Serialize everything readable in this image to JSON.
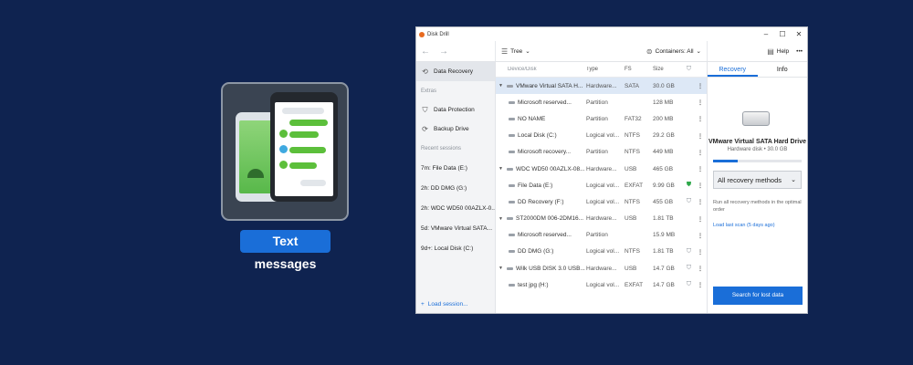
{
  "promo": {
    "label": "Text messages"
  },
  "window": {
    "title": "Disk Drill",
    "controls": {
      "minimize": "–",
      "maximize": "☐",
      "close": "✕"
    }
  },
  "toolbar": {
    "back": "←",
    "forward": "→",
    "view_label": "Tree",
    "containers_label": "Containers: All",
    "help_label": "Help",
    "more": "•••"
  },
  "sidebar": {
    "data_recovery": "Data Recovery",
    "extras_heading": "Extras",
    "data_protection": "Data Protection",
    "backup_drive": "Backup Drive",
    "recent_heading": "Recent sessions",
    "sessions": [
      "7m: File Data (E:)",
      "2h: DD DMG (G:)",
      "2h: WDC WD50 00AZLX-0...",
      "5d: VMware Virtual SATA...",
      "9d+: Local Disk (C:)"
    ],
    "load_session": "Load session..."
  },
  "columns": {
    "device": "Device/Disk",
    "type": "Type",
    "fs": "FS",
    "size": "Size"
  },
  "rows": [
    {
      "name": "VMware Virtual SATA H...",
      "type": "Hardware...",
      "fs": "SATA",
      "size": "30.0 GB",
      "level": 0
    },
    {
      "name": "Microsoft reserved...",
      "type": "Partition",
      "fs": "",
      "size": "128 MB",
      "level": 1
    },
    {
      "name": "NO NAME",
      "type": "Partition",
      "fs": "FAT32",
      "size": "200 MB",
      "level": 1
    },
    {
      "name": "Local Disk (C:)",
      "type": "Logical vol...",
      "fs": "NTFS",
      "size": "29.2 GB",
      "level": 1
    },
    {
      "name": "Microsoft recovery...",
      "type": "Partition",
      "fs": "NTFS",
      "size": "449 MB",
      "level": 1
    },
    {
      "name": "WDC WD50 00AZLX-08...",
      "type": "Hardware...",
      "fs": "USB",
      "size": "465 GB",
      "level": 0
    },
    {
      "name": "File Data (E:)",
      "type": "Logical vol...",
      "fs": "EXFAT",
      "size": "9.99 GB",
      "level": 1
    },
    {
      "name": "DD Recovery (F:)",
      "type": "Logical vol...",
      "fs": "NTFS",
      "size": "455 GB",
      "level": 1
    },
    {
      "name": "ST2000DM 006-2DM16...",
      "type": "Hardware...",
      "fs": "USB",
      "size": "1.81 TB",
      "level": 0
    },
    {
      "name": "Microsoft reserved...",
      "type": "Partition",
      "fs": "",
      "size": "15.9 MB",
      "level": 1
    },
    {
      "name": "DD DMG (G:)",
      "type": "Logical vol...",
      "fs": "NTFS",
      "size": "1.81 TB",
      "level": 1
    },
    {
      "name": "Wilk USB DISK 3.0 USB...",
      "type": "Hardware...",
      "fs": "USB",
      "size": "14.7 GB",
      "level": 0
    },
    {
      "name": "test jpg (H:)",
      "type": "Logical vol...",
      "fs": "EXFAT",
      "size": "14.7 GB",
      "level": 1
    }
  ],
  "right_panel": {
    "tab_recovery": "Recovery",
    "tab_info": "Info",
    "drive_name": "VMware Virtual SATA Hard Drive",
    "drive_sub": "Hardware disk • 30.0 GB",
    "used_fraction": 0.28,
    "method": "All recovery methods",
    "note": "Run all recovery methods in the optimal order",
    "last_scan": "Load last scan (5 days ago)",
    "search_button": "Search for lost data"
  },
  "colors": {
    "accent": "#1a6ed8",
    "background": "#0f2350",
    "protected": "#2ea84a"
  }
}
